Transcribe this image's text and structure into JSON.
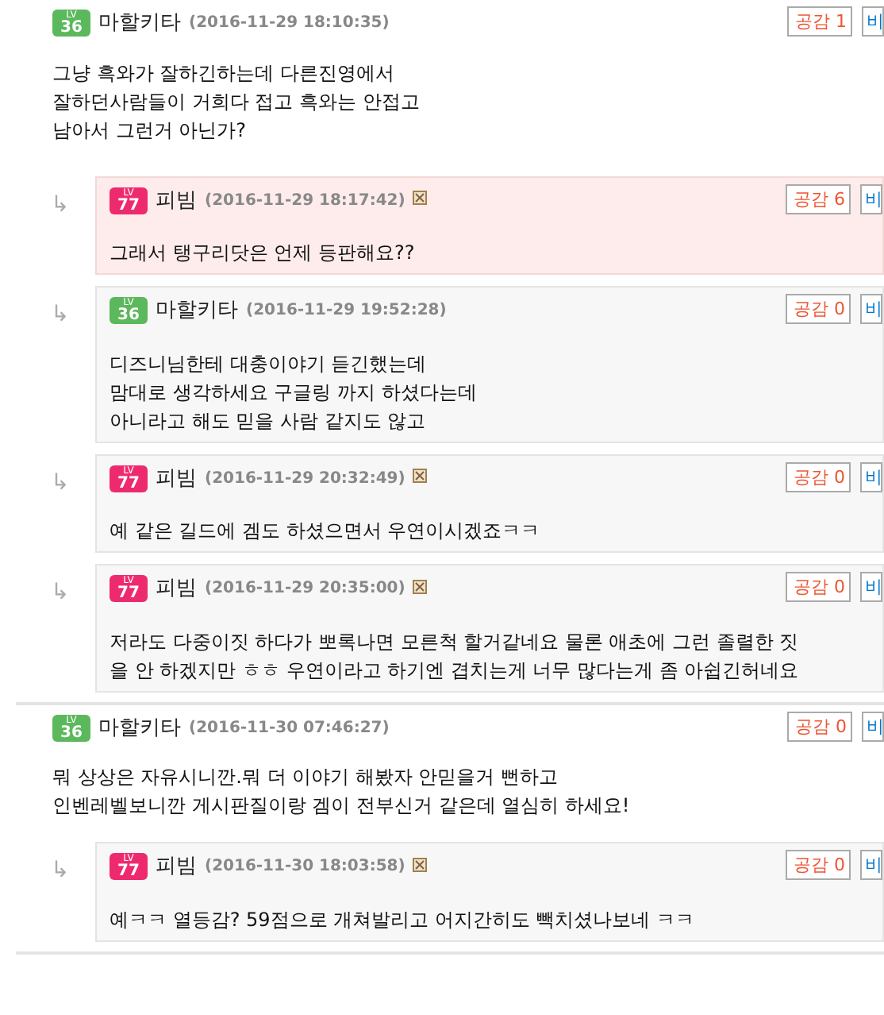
{
  "comments": [
    {
      "level_label": "LV",
      "level": "36",
      "color": "#5cb85c",
      "name": "마할키타",
      "time": "(2016-11-29 18:10:35)",
      "report": false,
      "buttons": [
        "공감 1",
        "비"
      ],
      "lines": [
        "그냥 흑와가 잘하긴하는데 다른진영에서",
        "잘하던사람들이 거희다 접고 흑와는 안접고",
        "남아서 그런거 아닌가?"
      ],
      "replies": [
        {
          "arrow": "↳",
          "level_label": "LV",
          "level": "77",
          "color": "#ee2a6e",
          "name": "피빔",
          "time": "(2016-11-29 18:17:42)",
          "report": true,
          "highlighted": true,
          "buttons": [
            "공감 6",
            "비"
          ],
          "lines": [
            "그래서 탱구리닷은 언제 등판해요??"
          ]
        },
        {
          "arrow": "↳",
          "level_label": "LV",
          "level": "36",
          "color": "#5cb85c",
          "name": "마할키타",
          "time": "(2016-11-29 19:52:28)",
          "report": false,
          "highlighted": false,
          "buttons": [
            "공감 0",
            "비"
          ],
          "lines": [
            "디즈니님한테 대충이야기 듣긴했는데",
            "맘대로 생각하세요 구글링 까지 하셨다는데",
            "아니라고 해도 믿을 사람 같지도 않고"
          ]
        },
        {
          "arrow": "↳",
          "level_label": "LV",
          "level": "77",
          "color": "#ee2a6e",
          "name": "피빔",
          "time": "(2016-11-29 20:32:49)",
          "report": true,
          "highlighted": false,
          "buttons": [
            "공감 0",
            "비"
          ],
          "lines": [
            "예 같은 길드에 겜도 하셨으면서 우연이시겠죠ㅋㅋ"
          ]
        },
        {
          "arrow": "↳",
          "level_label": "LV",
          "level": "77",
          "color": "#ee2a6e",
          "name": "피빔",
          "time": "(2016-11-29 20:35:00)",
          "report": true,
          "highlighted": false,
          "buttons": [
            "공감 0",
            "비"
          ],
          "lines": [
            "저라도 다중이짓 하다가 뽀록나면 모른척 할거같네요 물론 애초에 그런 졸렬한 짓",
            "을 안 하겠지만 ㅎㅎ 우연이라고 하기엔 겹치는게 너무 많다는게 좀 아쉽긴허네요"
          ]
        }
      ]
    },
    {
      "level_label": "LV",
      "level": "36",
      "color": "#5cb85c",
      "name": "마할키타",
      "time": "(2016-11-30 07:46:27)",
      "report": false,
      "buttons": [
        "공감 0",
        "비"
      ],
      "lines": [
        "뭐 상상은 자유시니깐.뭐 더 이야기 해봤자 안믿을거 뻔하고",
        "인벤레벨보니깐 게시판질이랑 겜이 전부신거 같은데 열심히 하세요!"
      ],
      "replies": [
        {
          "arrow": "↳",
          "level_label": "LV",
          "level": "77",
          "color": "#ee2a6e",
          "name": "피빔",
          "time": "(2016-11-30 18:03:58)",
          "report": true,
          "highlighted": false,
          "buttons": [
            "공감 0",
            "비"
          ],
          "lines": [
            "예ㅋㅋ 열등감? 59점으로 개쳐발리고 어지간히도 빽치셨나보네 ㅋㅋ"
          ]
        }
      ]
    }
  ]
}
